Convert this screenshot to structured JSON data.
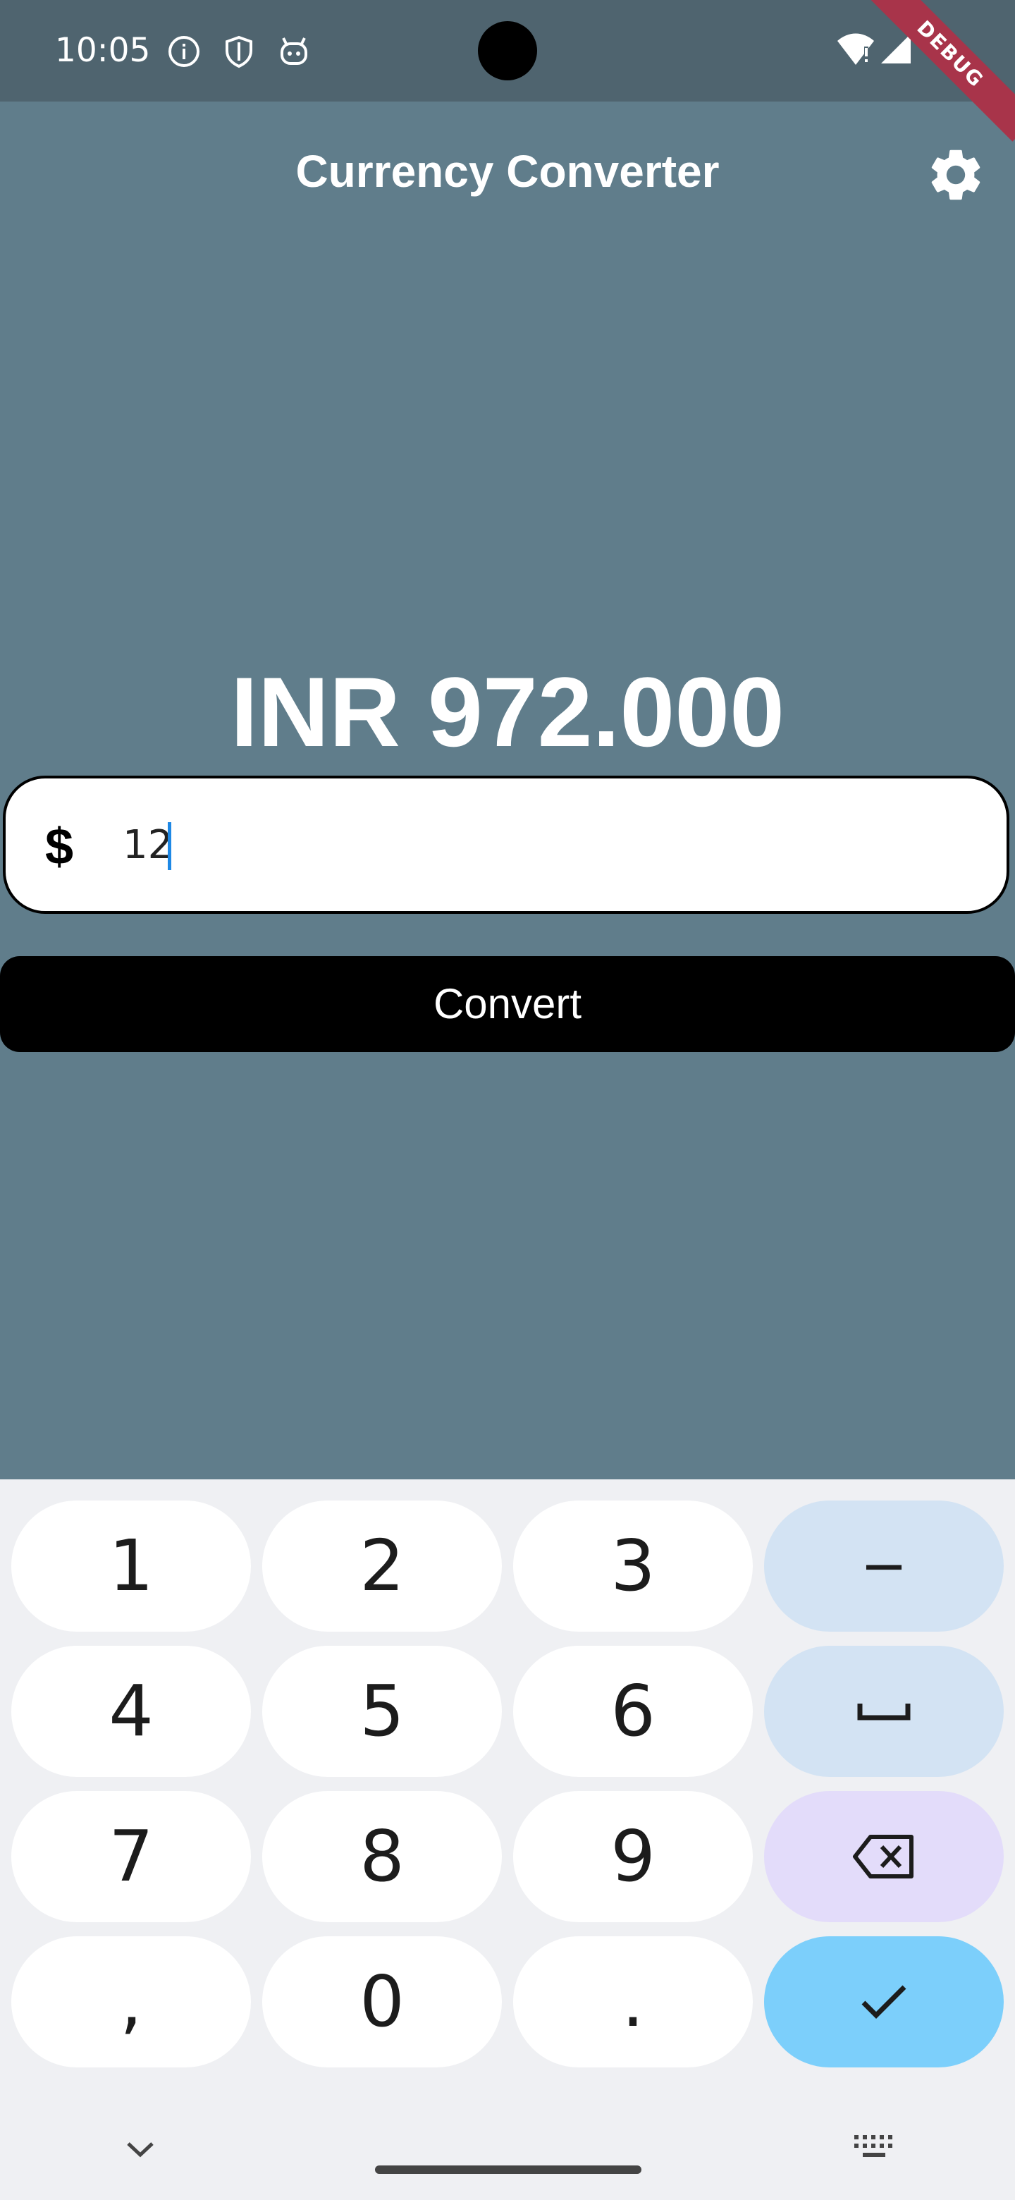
{
  "status_bar": {
    "time": "10:05"
  },
  "debug_banner": "DEBUG",
  "app_bar": {
    "title": "Currency Converter",
    "settings_icon": "gear-icon"
  },
  "result": {
    "text": "INR 972.000"
  },
  "amount_field": {
    "prefix": "$",
    "value": "12"
  },
  "convert_button": {
    "label": "Convert"
  },
  "keyboard": {
    "keys": [
      "1",
      "2",
      "3",
      "−",
      "4",
      "5",
      "6",
      "space",
      "7",
      "8",
      "9",
      "backspace",
      ",",
      "0",
      ".",
      "done"
    ],
    "labels": {
      "k1": "1",
      "k2": "2",
      "k3": "3",
      "k4": "4",
      "k5": "5",
      "k6": "6",
      "k7": "7",
      "k8": "8",
      "k9": "9",
      "k0": "0",
      "comma": ",",
      "dot": ".",
      "minus": "−"
    }
  },
  "colors": {
    "background": "#607d8b",
    "status_bar": "#4f646f",
    "accent": "#1e88e5",
    "done_key": "#7ccffb"
  }
}
